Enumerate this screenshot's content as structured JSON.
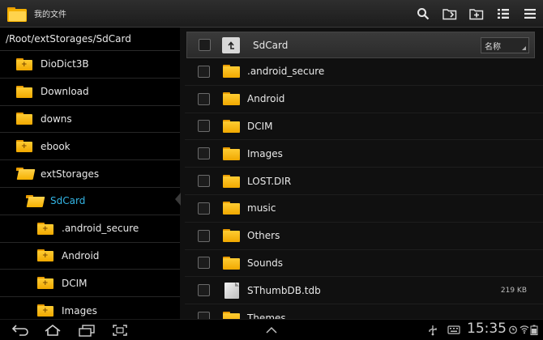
{
  "app": {
    "title": "我的文件"
  },
  "left_panel": {
    "path": "/Root/extStorages/SdCard",
    "items": [
      {
        "label": "DioDict3B",
        "indent": 0,
        "type": "plus",
        "selected": false
      },
      {
        "label": "Download",
        "indent": 0,
        "type": "plain",
        "selected": false
      },
      {
        "label": "downs",
        "indent": 0,
        "type": "plain",
        "selected": false
      },
      {
        "label": "ebook",
        "indent": 0,
        "type": "plus",
        "selected": false
      },
      {
        "label": "extStorages",
        "indent": 0,
        "type": "open",
        "selected": false
      },
      {
        "label": "SdCard",
        "indent": 1,
        "type": "open",
        "selected": true
      },
      {
        "label": ".android_secure",
        "indent": 2,
        "type": "plus",
        "selected": false
      },
      {
        "label": "Android",
        "indent": 2,
        "type": "plus",
        "selected": false
      },
      {
        "label": "DCIM",
        "indent": 2,
        "type": "plus",
        "selected": false
      },
      {
        "label": "Images",
        "indent": 2,
        "type": "plus",
        "selected": false
      }
    ]
  },
  "right_panel": {
    "header_title": "SdCard",
    "sort_label": "名称",
    "rows": [
      {
        "name": ".android_secure",
        "kind": "folder",
        "size": ""
      },
      {
        "name": "Android",
        "kind": "folder",
        "size": ""
      },
      {
        "name": "DCIM",
        "kind": "folder",
        "size": ""
      },
      {
        "name": "Images",
        "kind": "folder",
        "size": ""
      },
      {
        "name": "LOST.DIR",
        "kind": "folder",
        "size": ""
      },
      {
        "name": "music",
        "kind": "folder",
        "size": ""
      },
      {
        "name": "Others",
        "kind": "folder",
        "size": ""
      },
      {
        "name": "Sounds",
        "kind": "folder",
        "size": ""
      },
      {
        "name": "SThumbDB.tdb",
        "kind": "file",
        "size": "219 KB"
      },
      {
        "name": "Themes",
        "kind": "folder",
        "size": ""
      }
    ]
  },
  "status_bar": {
    "clock": "15:35"
  },
  "icons": {
    "actions": [
      "search-icon",
      "new-folder-icon",
      "add-icon",
      "list-view-icon",
      "menu-icon"
    ],
    "nav": [
      "back-icon",
      "home-icon",
      "recent-apps-icon",
      "screenshot-icon"
    ]
  },
  "colors": {
    "accent": "#33b5e5",
    "folder": "#f5b000"
  }
}
